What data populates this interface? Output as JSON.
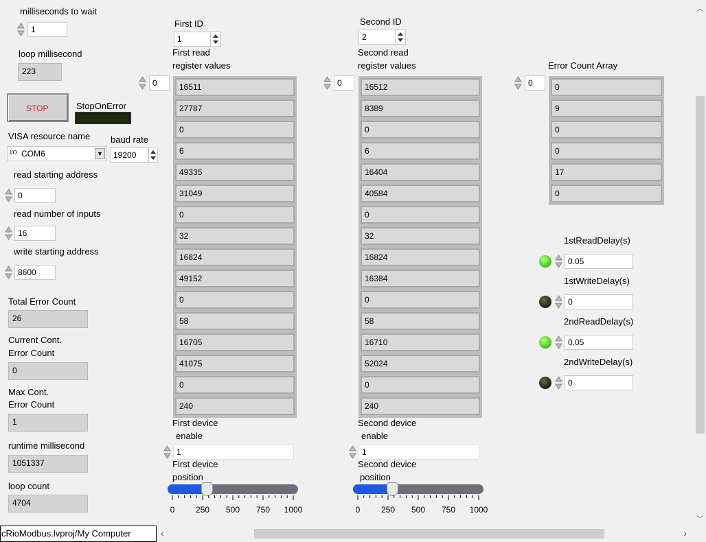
{
  "left": {
    "ms_wait_label": "milliseconds to wait",
    "ms_wait_value": "1",
    "loop_ms_label": "loop millisecond",
    "loop_ms_value": "223",
    "stop_label": "STOP",
    "stop_on_error_label": "StopOnError",
    "visa_label": "VISA resource name",
    "visa_value": "COM6",
    "visa_prefix": "I/O",
    "baud_label": "baud rate",
    "baud_value": "19200",
    "read_start_label": "read starting address",
    "read_start_value": "0",
    "read_num_label": "read number of inputs",
    "read_num_value": "16",
    "write_start_label": "write starting address",
    "write_start_value": "8600",
    "total_err_label": "Total Error Count",
    "total_err_value": "26",
    "cur_err_label_1": "Current Cont.",
    "cur_err_label_2": "Error Count",
    "cur_err_value": "0",
    "max_err_label_1": "Max Cont.",
    "max_err_label_2": "Error Count",
    "max_err_value": "1",
    "runtime_label": "runtime millisecond",
    "runtime_value": "1051337",
    "loop_count_label": "loop count",
    "loop_count_value": "4704"
  },
  "first": {
    "id_label": "First ID",
    "id_value": "1",
    "reg_label_1": "First read",
    "reg_label_2": "register values",
    "index": "0",
    "values": [
      "16511",
      "27787",
      "0",
      "6",
      "49335",
      "31049",
      "0",
      "32",
      "16824",
      "49152",
      "0",
      "58",
      "16705",
      "41075",
      "0",
      "240"
    ],
    "enable_label_1": "First device",
    "enable_label_2": "enable",
    "enable_value": "1",
    "pos_label_1": "First device",
    "pos_label_2": "position",
    "position": 250
  },
  "second": {
    "id_label": "Second ID",
    "id_value": "2",
    "reg_label_1": "Second read",
    "reg_label_2": "register values",
    "index": "0",
    "values": [
      "16512",
      "8389",
      "0",
      "6",
      "16404",
      "40584",
      "0",
      "32",
      "16824",
      "16384",
      "0",
      "58",
      "16710",
      "52024",
      "0",
      "240"
    ],
    "enable_label_1": "Second device",
    "enable_label_2": "enable",
    "enable_value": "1",
    "pos_label_1": "Second device",
    "pos_label_2": "position",
    "position": 250
  },
  "slider_ticks": [
    "0",
    "250",
    "500",
    "750",
    "1000"
  ],
  "errors": {
    "label": "Error Count Array",
    "index": "0",
    "values": [
      "0",
      "9",
      "0",
      "0",
      "17",
      "0"
    ]
  },
  "delays": [
    {
      "label": "1stReadDelay(s)",
      "value": "0.05",
      "led": "on"
    },
    {
      "label": "1stWriteDelay(s)",
      "value": "0",
      "led": "off"
    },
    {
      "label": "2ndReadDelay(s)",
      "value": "0.05",
      "led": "on"
    },
    {
      "label": "2ndWriteDelay(s)",
      "value": "0",
      "led": "off"
    }
  ],
  "statusbar": {
    "project_path": "cRioModbus.lvproj/My Computer"
  },
  "colors": {
    "stop_text": "#e02020",
    "led_on": "#59e02a",
    "led_off": "#1e2b15",
    "slider_fill": "#1f58e6"
  }
}
